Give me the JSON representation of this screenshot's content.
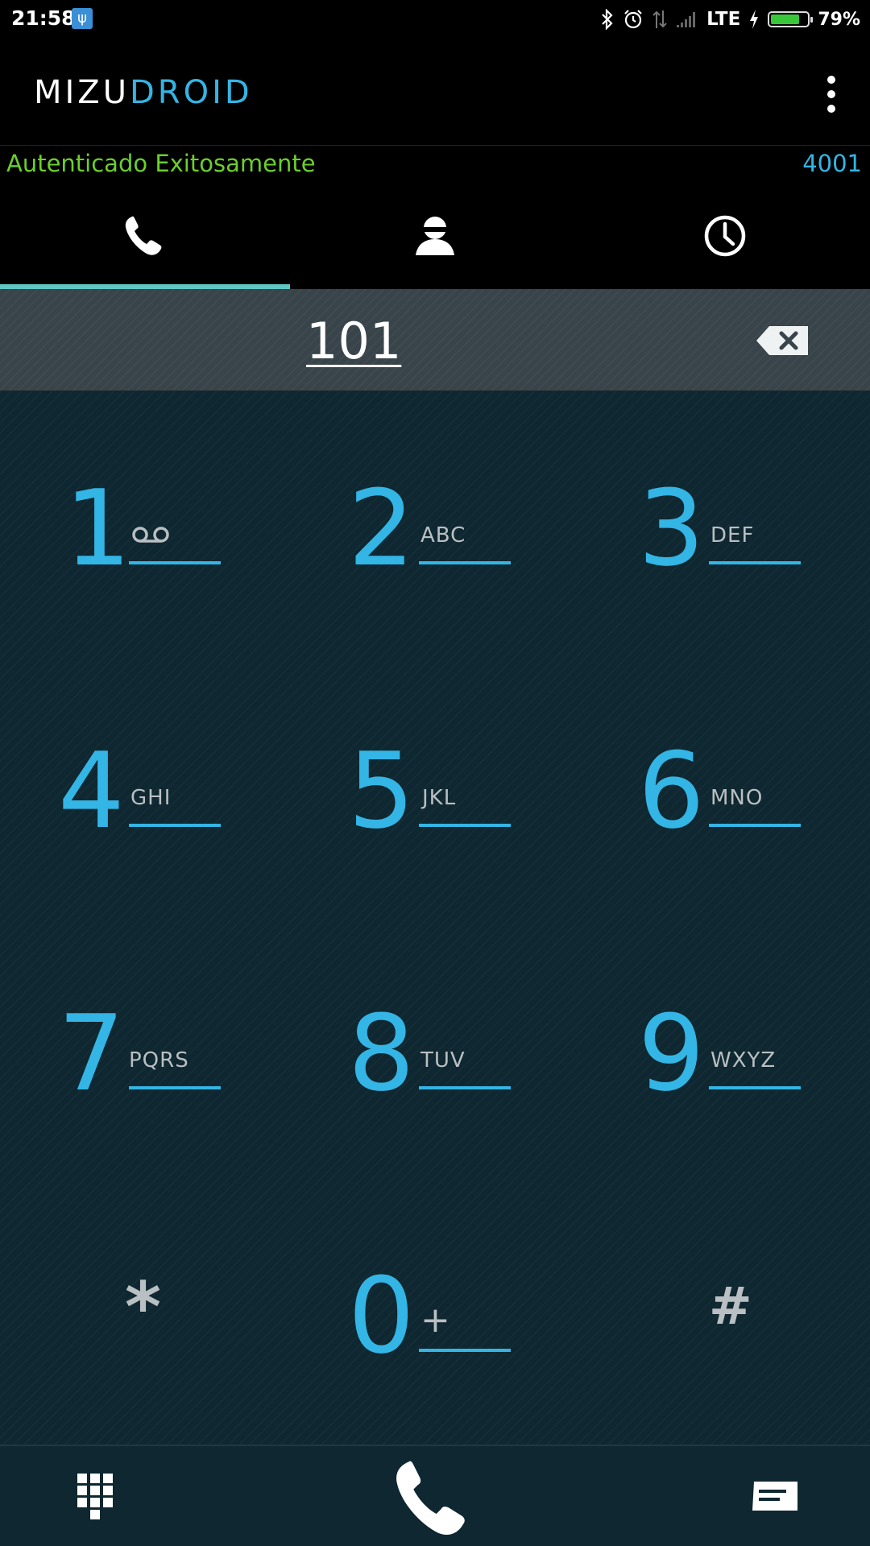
{
  "status_bar": {
    "time": "21:58",
    "network": "LTE",
    "battery_percent": "79%",
    "battery_level": 0.79,
    "icons": [
      "usb-icon",
      "bluetooth-icon",
      "alarm-icon",
      "data-arrows-icon",
      "signal-icon",
      "charging-icon",
      "battery-icon"
    ]
  },
  "app": {
    "logo_part1": "MIZU",
    "logo_part2": "DROID",
    "menu_icon": "overflow-menu-icon",
    "brand_color": "#33b5e5"
  },
  "account": {
    "status": "Autenticado Exitosamente",
    "status_color": "#6ad02a",
    "extension": "4001"
  },
  "tabs": [
    {
      "icon": "phone-icon",
      "selected": true
    },
    {
      "icon": "contact-icon",
      "selected": false
    },
    {
      "icon": "history-clock-icon",
      "selected": false
    }
  ],
  "dialer": {
    "number": "101",
    "backspace_icon": "backspace-icon"
  },
  "keypad": {
    "keys": [
      {
        "digit": "1",
        "letters": "",
        "extra_icon": "voicemail-icon"
      },
      {
        "digit": "2",
        "letters": "ABC"
      },
      {
        "digit": "3",
        "letters": "DEF"
      },
      {
        "digit": "4",
        "letters": "GHI"
      },
      {
        "digit": "5",
        "letters": "JKL"
      },
      {
        "digit": "6",
        "letters": "MNO"
      },
      {
        "digit": "7",
        "letters": "PQRS"
      },
      {
        "digit": "8",
        "letters": "TUV"
      },
      {
        "digit": "9",
        "letters": "WXYZ"
      },
      {
        "digit": "*",
        "letters": ""
      },
      {
        "digit": "0",
        "letters": "+"
      },
      {
        "digit": "#",
        "letters": ""
      }
    ]
  },
  "bottom_bar": {
    "left_icon": "dialpad-icon",
    "center_icon": "call-icon",
    "right_icon": "message-icon"
  }
}
